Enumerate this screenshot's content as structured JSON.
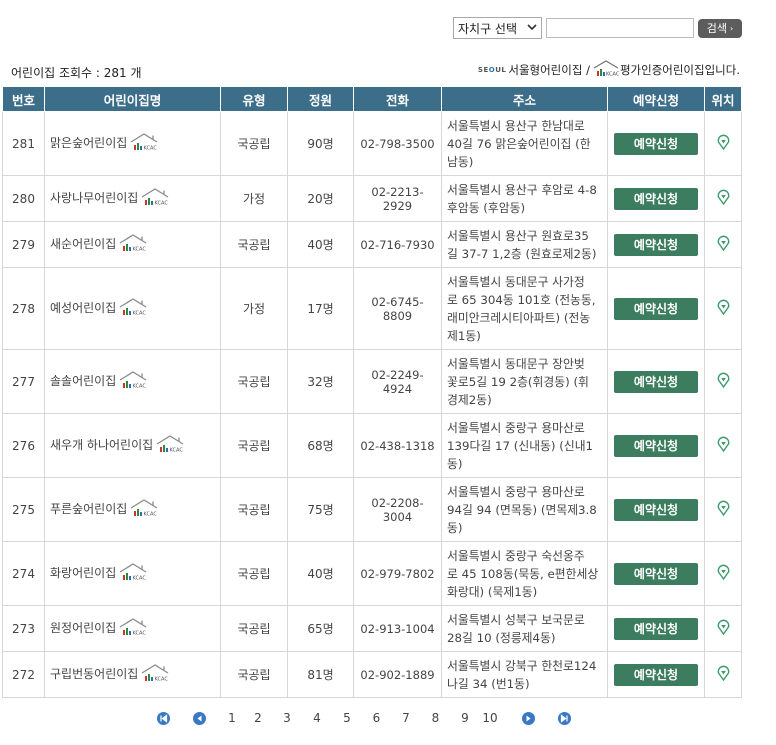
{
  "search": {
    "district_label": "자치구 선택",
    "query_value": "",
    "button_label": "검색"
  },
  "summary": {
    "count_text": "어린이집 조회수 : 281 개",
    "legend_seoul_text": "서울형어린이집 /",
    "legend_cert_text": "평가인증어린이집입니다."
  },
  "table": {
    "headers": [
      "번호",
      "어린이집명",
      "유형",
      "정원",
      "전화",
      "주소",
      "예약신청",
      "위치"
    ],
    "reserve_label": "예약신청",
    "rows": [
      {
        "no": "281",
        "name": "맑은숲어린이집",
        "type": "국공립",
        "capacity": "90명",
        "tel": "02-798-3500",
        "addr": [
          "서울특별시 용산구 한남대로",
          "40길 76 맑은숲어린이집 (한",
          "남동)"
        ]
      },
      {
        "no": "280",
        "name": "사랑나무어린이집",
        "type": "가정",
        "capacity": "20명",
        "tel": "02-2213-2929",
        "addr": [
          "서울특별시 용산구 후암로 4-8",
          "후암동 (후암동)"
        ]
      },
      {
        "no": "279",
        "name": "새순어린이집",
        "type": "국공립",
        "capacity": "40명",
        "tel": "02-716-7930",
        "addr": [
          "서울특별시 용산구 원효로35",
          "길 37-7 1,2층 (원효로제2동)"
        ]
      },
      {
        "no": "278",
        "name": "예성어린이집",
        "type": "가정",
        "capacity": "17명",
        "tel": "02-6745-8809",
        "addr": [
          "서울특별시 동대문구 사가정",
          "로 65 304동 101호 (전농동,",
          "래미안크레시티아파트) (전농",
          "제1동)"
        ]
      },
      {
        "no": "277",
        "name": "솔솔어린이집",
        "type": "국공립",
        "capacity": "32명",
        "tel": "02-2249-4924",
        "addr": [
          "서울특별시 동대문구 장안벚",
          "꽃로5길 19 2층(휘경동) (휘",
          "경제2동)"
        ]
      },
      {
        "no": "276",
        "name": "새우개 하나어린이집",
        "type": "국공립",
        "capacity": "68명",
        "tel": "02-438-1318",
        "addr": [
          "서울특별시 중랑구 용마산로",
          "139다길 17 (신내동) (신내1",
          "동)"
        ]
      },
      {
        "no": "275",
        "name": "푸른숲어린이집",
        "type": "국공립",
        "capacity": "75명",
        "tel": "02-2208-3004",
        "addr": [
          "서울특별시 중랑구 용마산로",
          "94길 94 (면목동) (면목제3.8",
          "동)"
        ]
      },
      {
        "no": "274",
        "name": "화랑어린이집",
        "type": "국공립",
        "capacity": "40명",
        "tel": "02-979-7802",
        "addr": [
          "서울특별시 중랑구 숙선옹주",
          "로 45 108동(묵동, e편한세상",
          "화랑대) (묵제1동)"
        ]
      },
      {
        "no": "273",
        "name": "원정어린이집",
        "type": "국공립",
        "capacity": "65명",
        "tel": "02-913-1004",
        "addr": [
          "서울특별시 성북구 보국문로",
          "28길 10 (정릉제4동)"
        ]
      },
      {
        "no": "272",
        "name": "구립번동어린이집",
        "type": "국공립",
        "capacity": "81명",
        "tel": "02-902-1889",
        "addr": [
          "서울특별시 강북구 한천로124",
          "나길 34 (번1동)"
        ]
      }
    ]
  },
  "pagination": {
    "pages": [
      "1",
      "2",
      "3",
      "4",
      "5",
      "6",
      "7",
      "8",
      "9",
      "10"
    ],
    "current": "1"
  },
  "colors": {
    "header_bg": "#3c6e8a",
    "reserve_btn": "#3b7d5e",
    "pin": "#3b9a6a",
    "pager_arrow": "#3a78c4"
  },
  "icons": {
    "first_page": "double-chevron-left-icon",
    "prev_page": "chevron-left-icon",
    "next_page": "chevron-right-icon",
    "last_page": "double-chevron-right-icon",
    "location": "map-pin-icon",
    "certification": "kcac-house-icon"
  }
}
